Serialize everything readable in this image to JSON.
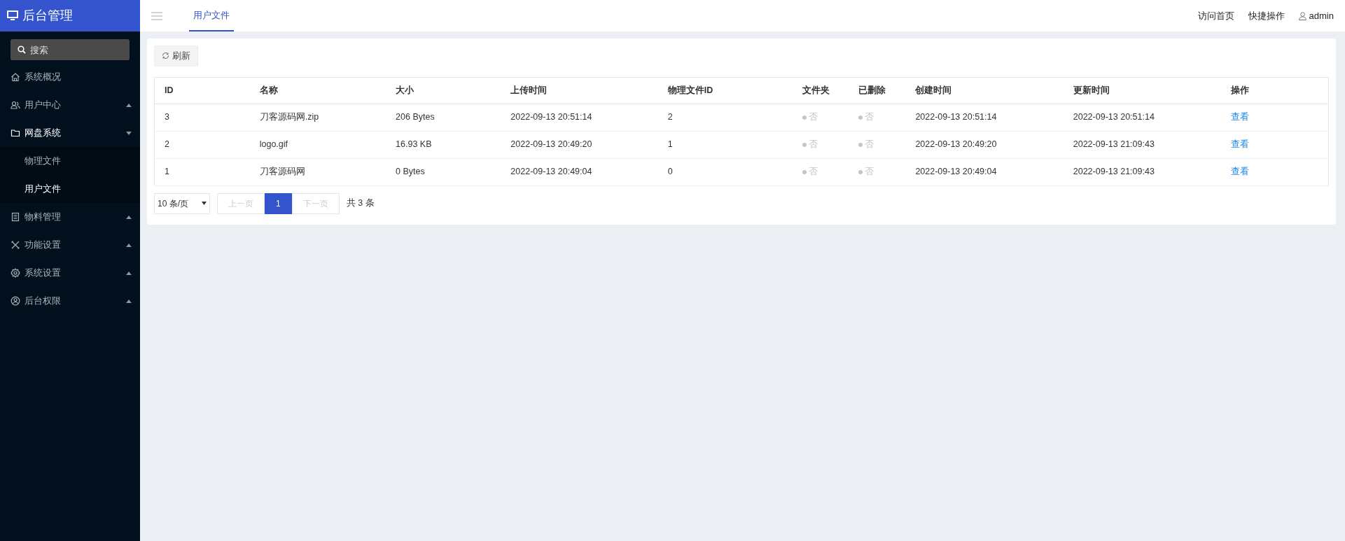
{
  "brand": {
    "title": "后台管理"
  },
  "search": {
    "placeholder": "搜索"
  },
  "sidebar": {
    "items": [
      {
        "label": "系统概况",
        "expandable": false,
        "expanded": false
      },
      {
        "label": "用户中心",
        "expandable": true,
        "expanded": false
      },
      {
        "label": "网盘系统",
        "expandable": true,
        "expanded": true,
        "children": [
          {
            "label": "物理文件",
            "selected": false
          },
          {
            "label": "用户文件",
            "selected": true
          }
        ]
      },
      {
        "label": "物料管理",
        "expandable": true,
        "expanded": false
      },
      {
        "label": "功能设置",
        "expandable": true,
        "expanded": false
      },
      {
        "label": "系统设置",
        "expandable": true,
        "expanded": false
      },
      {
        "label": "后台权限",
        "expandable": true,
        "expanded": false
      }
    ]
  },
  "tabs": [
    {
      "label": "用户文件",
      "selected": true
    }
  ],
  "header_links": [
    {
      "label": "访问首页"
    },
    {
      "label": "快捷操作"
    },
    {
      "label": "admin"
    }
  ],
  "toolbar": {
    "refresh": "刷新"
  },
  "table": {
    "columns": [
      "ID",
      "名称",
      "大小",
      "上传时间",
      "物理文件ID",
      "文件夹",
      "已删除",
      "创建时间",
      "更新时间",
      "操作"
    ],
    "rows": [
      {
        "id": "3",
        "name": "刀客源码网.zip",
        "size": "206 Bytes",
        "uploaded": "2022-09-13 20:51:14",
        "physical_id": "2",
        "folder": {
          "text": "否",
          "on": false
        },
        "deleted": {
          "text": "否",
          "on": false
        },
        "created": "2022-09-13 20:51:14",
        "updated": "2022-09-13 20:51:14",
        "action": "查看"
      },
      {
        "id": "2",
        "name": "logo.gif",
        "size": "16.93 KB",
        "uploaded": "2022-09-13 20:49:20",
        "physical_id": "1",
        "folder": {
          "text": "否",
          "on": false
        },
        "deleted": {
          "text": "否",
          "on": false
        },
        "created": "2022-09-13 20:49:20",
        "updated": "2022-09-13 21:09:43",
        "action": "查看"
      },
      {
        "id": "1",
        "name": "刀客源码网",
        "size": "0 Bytes",
        "uploaded": "2022-09-13 20:49:04",
        "physical_id": "0",
        "folder": {
          "text": "否",
          "on": false
        },
        "deleted": {
          "text": "否",
          "on": false
        },
        "created": "2022-09-13 20:49:04",
        "updated": "2022-09-13 21:09:43",
        "action": "查看"
      }
    ]
  },
  "pagination": {
    "page_size": "10 条/页",
    "prev": {
      "label": "上一页",
      "disabled": true
    },
    "pages": [
      {
        "label": "1",
        "selected": true
      }
    ],
    "next": {
      "label": "下一页",
      "disabled": true
    },
    "total": "共 3 条"
  }
}
